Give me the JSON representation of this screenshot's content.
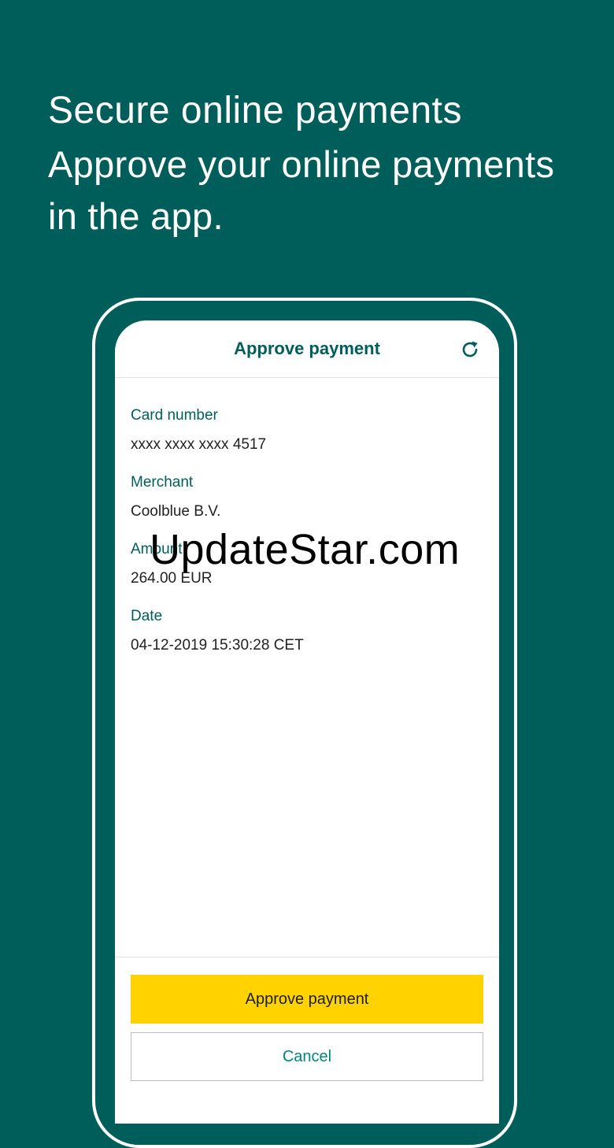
{
  "promo": {
    "title": "Secure online payments",
    "subtitle_line1": "Approve your online payments",
    "subtitle_line2": "in the app."
  },
  "screen": {
    "title": "Approve payment",
    "refresh_icon": "refresh-icon",
    "fields": [
      {
        "label": "Card number",
        "value": "xxxx xxxx xxxx 4517"
      },
      {
        "label": "Merchant",
        "value": "Coolblue B.V."
      },
      {
        "label": "Amount",
        "value": "264.00 EUR"
      },
      {
        "label": "Date",
        "value": "04-12-2019 15:30:28 CET"
      }
    ],
    "approve_label": "Approve payment",
    "cancel_label": "Cancel"
  },
  "watermark": "UpdateStar.com",
  "colors": {
    "background": "#005e5a",
    "accent_text": "#005e5a",
    "approve_button": "#ffd200",
    "cancel_text": "#00857c"
  }
}
